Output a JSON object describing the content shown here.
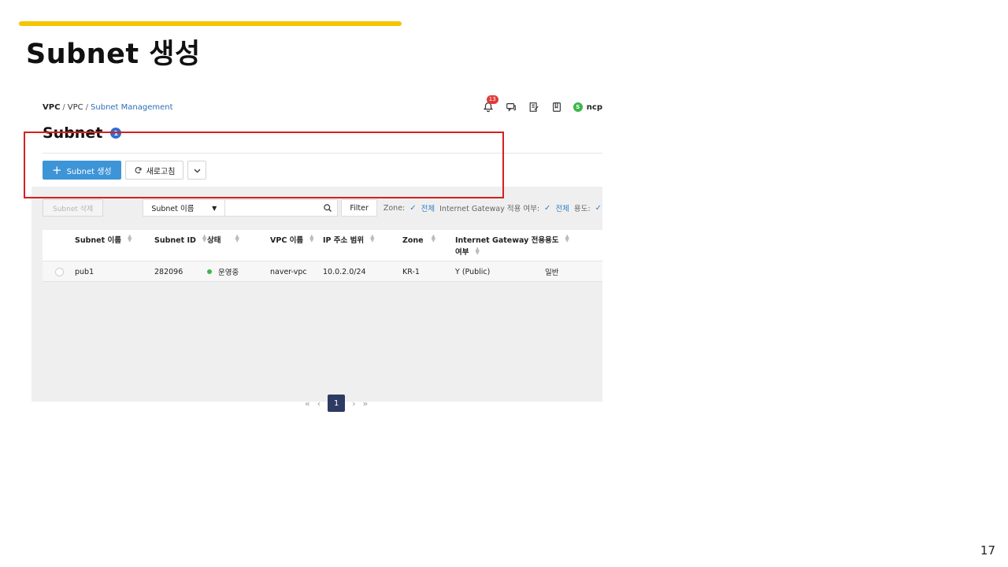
{
  "slide": {
    "title": "Subnet 생성",
    "page_number": "17",
    "accent_color": "#f5c400"
  },
  "console": {
    "breadcrumb": {
      "root": "VPC",
      "sep1": "/",
      "mid": "VPC",
      "sep2": "/",
      "current": "Subnet Management"
    },
    "notifications_count": "13",
    "header_icons": [
      "bell-icon",
      "chat-icon",
      "edit-icon",
      "book-icon"
    ],
    "user": {
      "initial": "S",
      "name": "ncp"
    },
    "heading": "Subnet",
    "heading_count": "1",
    "toolbar": {
      "create_label": "Subnet 생성",
      "refresh_label": "새로고침"
    },
    "filters": {
      "delete_label": "Subnet 삭제",
      "search_field": "Subnet 이름",
      "search_value": "",
      "filter_label": "Filter",
      "zone_label": "Zone:",
      "zone_value": "전체",
      "igw_label": "Internet Gateway 적용 여부:",
      "igw_value": "전체",
      "usage_label": "용도:"
    },
    "table": {
      "columns": [
        "Subnet 이름",
        "Subnet ID",
        "상태",
        "VPC 이름",
        "IP 주소 범위",
        "Zone",
        "Internet Gateway 전용",
        "여부",
        "용도"
      ],
      "rows": [
        {
          "name": "pub1",
          "id": "282096",
          "status": "운영중",
          "vpc": "naver-vpc",
          "ip_range": "10.0.2.0/24",
          "zone": "KR-1",
          "igw": "Y (Public)",
          "usage": "일반"
        }
      ]
    },
    "pagination": {
      "first": "«",
      "prev": "‹",
      "current": "1",
      "next": "›",
      "last": "»"
    },
    "colors": {
      "primary_button": "#3d95d8",
      "status_green": "#3cb64a",
      "highlight_red": "#d52020",
      "page_active": "#2d3b63"
    }
  }
}
